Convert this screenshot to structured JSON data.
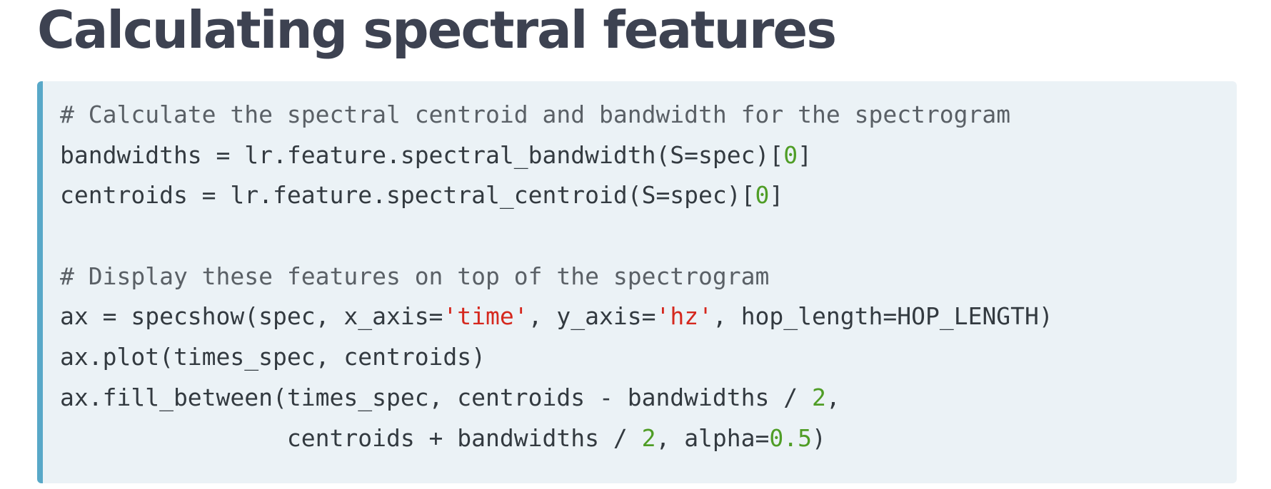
{
  "title": "Calculating spectral features",
  "colors": {
    "title": "#3d4251",
    "code_background": "#ebf2f6",
    "code_border": "#58a8c8",
    "code_text": "#333a40",
    "comment": "#5a6066",
    "number": "#4f9d26",
    "string": "#d5281e"
  },
  "code": {
    "language": "python",
    "lines": [
      [
        {
          "type": "comment",
          "text": "# Calculate the spectral centroid and bandwidth for the spectrogram"
        }
      ],
      [
        {
          "type": "plain",
          "text": "bandwidths = lr.feature.spectral_bandwidth(S=spec)["
        },
        {
          "type": "num",
          "text": "0"
        },
        {
          "type": "plain",
          "text": "]"
        }
      ],
      [
        {
          "type": "plain",
          "text": "centroids = lr.feature.spectral_centroid(S=spec)["
        },
        {
          "type": "num",
          "text": "0"
        },
        {
          "type": "plain",
          "text": "]"
        }
      ],
      [],
      [
        {
          "type": "comment",
          "text": "# Display these features on top of the spectrogram"
        }
      ],
      [
        {
          "type": "plain",
          "text": "ax = specshow(spec, x_axis="
        },
        {
          "type": "str",
          "text": "'time'"
        },
        {
          "type": "plain",
          "text": ", y_axis="
        },
        {
          "type": "str",
          "text": "'hz'"
        },
        {
          "type": "plain",
          "text": ", hop_length=HOP_LENGTH)"
        }
      ],
      [
        {
          "type": "plain",
          "text": "ax.plot(times_spec, centroids)"
        }
      ],
      [
        {
          "type": "plain",
          "text": "ax.fill_between(times_spec, centroids - bandwidths / "
        },
        {
          "type": "num",
          "text": "2"
        },
        {
          "type": "plain",
          "text": ","
        }
      ],
      [
        {
          "type": "plain",
          "text": "                centroids + bandwidths / "
        },
        {
          "type": "num",
          "text": "2"
        },
        {
          "type": "plain",
          "text": ", alpha="
        },
        {
          "type": "num",
          "text": "0.5"
        },
        {
          "type": "plain",
          "text": ")"
        }
      ]
    ]
  }
}
